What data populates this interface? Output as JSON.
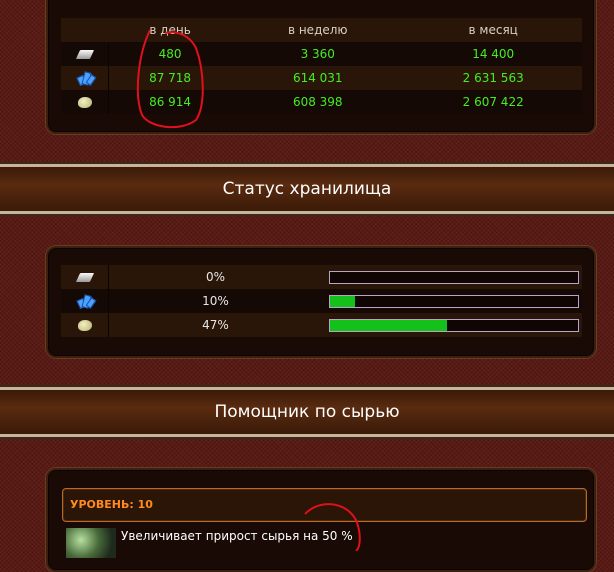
{
  "production": {
    "headers": [
      "в день",
      "в неделю",
      "в месяц"
    ],
    "rows": [
      {
        "resource": "metal-icon",
        "per_day": "480",
        "per_week": "3 360",
        "per_month": "14 400"
      },
      {
        "resource": "crystal-icon",
        "per_day": "87 718",
        "per_week": "614 031",
        "per_month": "2 631 563"
      },
      {
        "resource": "deuterium-icon",
        "per_day": "86 914",
        "per_week": "608 398",
        "per_month": "2 607 422"
      }
    ]
  },
  "storage": {
    "title": "Статус хранилища",
    "rows": [
      {
        "resource": "metal-icon",
        "percent_label": "0%",
        "fill": 0.0
      },
      {
        "resource": "crystal-icon",
        "percent_label": "10%",
        "fill": 0.1
      },
      {
        "resource": "deuterium-icon",
        "percent_label": "47%",
        "fill": 0.47
      }
    ]
  },
  "helper": {
    "title": "Помощник по сырью",
    "level_label": "УРОВЕНЬ: 10",
    "description": "Увеличивает прирост сырья на 50 %"
  },
  "colors": {
    "value_green": "#44ee22",
    "bar_fill": "#14c01a",
    "level_orange": "#ff8a1e",
    "annotation_red": "#e0101c"
  }
}
